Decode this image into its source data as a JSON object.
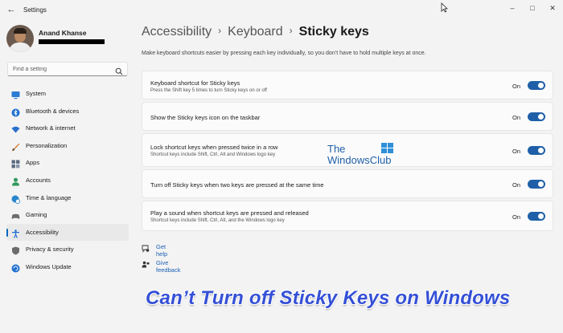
{
  "window": {
    "title": "Settings",
    "back_glyph": "←",
    "minimize_glyph": "–",
    "maximize_glyph": "□",
    "close_glyph": "✕"
  },
  "user": {
    "name": "Anand Khanse"
  },
  "search": {
    "placeholder": "Find a setting"
  },
  "sidebar": {
    "items": [
      {
        "label": "System",
        "icon": "monitor-icon",
        "color": "#2b7cd3"
      },
      {
        "label": "Bluetooth & devices",
        "icon": "bluetooth-icon",
        "color": "#1f6fcf"
      },
      {
        "label": "Network & internet",
        "icon": "wifi-icon",
        "color": "#2a6fcc"
      },
      {
        "label": "Personalization",
        "icon": "brush-icon",
        "color": "#d4762a"
      },
      {
        "label": "Apps",
        "icon": "apps-icon",
        "color": "#5a6a80"
      },
      {
        "label": "Accounts",
        "icon": "account-icon",
        "color": "#2e9a5a"
      },
      {
        "label": "Time & language",
        "icon": "globe-clock-icon",
        "color": "#2a86cc"
      },
      {
        "label": "Gaming",
        "icon": "gamepad-icon",
        "color": "#6b6b6b"
      },
      {
        "label": "Accessibility",
        "icon": "accessibility-icon",
        "color": "#1f6fcf",
        "active": true
      },
      {
        "label": "Privacy & security",
        "icon": "shield-icon",
        "color": "#6b6b6b"
      },
      {
        "label": "Windows Update",
        "icon": "update-icon",
        "color": "#1f6fcf"
      }
    ]
  },
  "breadcrumb": {
    "items": [
      "Accessibility",
      "Keyboard",
      "Sticky keys"
    ],
    "separator": "›"
  },
  "description": "Make keyboard shortcuts easier by pressing each key individually, so you don’t have to hold multiple keys at once.",
  "settings": [
    {
      "title": "Keyboard shortcut for Sticky keys",
      "subtitle": "Press the Shift key 5 times to turn Sticky keys on or off",
      "state": "On",
      "on": true
    },
    {
      "title": "Show the Sticky keys icon on the taskbar",
      "subtitle": "",
      "state": "On",
      "on": true
    },
    {
      "title": "Lock shortcut keys when pressed twice in a row",
      "subtitle": "Shortcut keys include Shift, Ctrl, Alt and Windows logo key",
      "state": "On",
      "on": true
    },
    {
      "title": "Turn off Sticky keys when two keys are pressed at the same time",
      "subtitle": "",
      "state": "On",
      "on": true
    },
    {
      "title": "Play a sound when shortcut keys are pressed and released",
      "subtitle": "Shortcut keys include Shift, Ctrl, Alt, and the Windows logo key",
      "state": "On",
      "on": true
    }
  ],
  "links": [
    {
      "label": "Get help",
      "icon": "help-icon"
    },
    {
      "label": "Give feedback",
      "icon": "feedback-icon"
    }
  ],
  "watermark": {
    "line1": "The",
    "line2": "WindowsClub"
  },
  "caption": "Can’t Turn off Sticky Keys on Windows",
  "colors": {
    "accent": "#1f5fa8",
    "caption": "#3550d6",
    "link": "#1a5fb4"
  }
}
